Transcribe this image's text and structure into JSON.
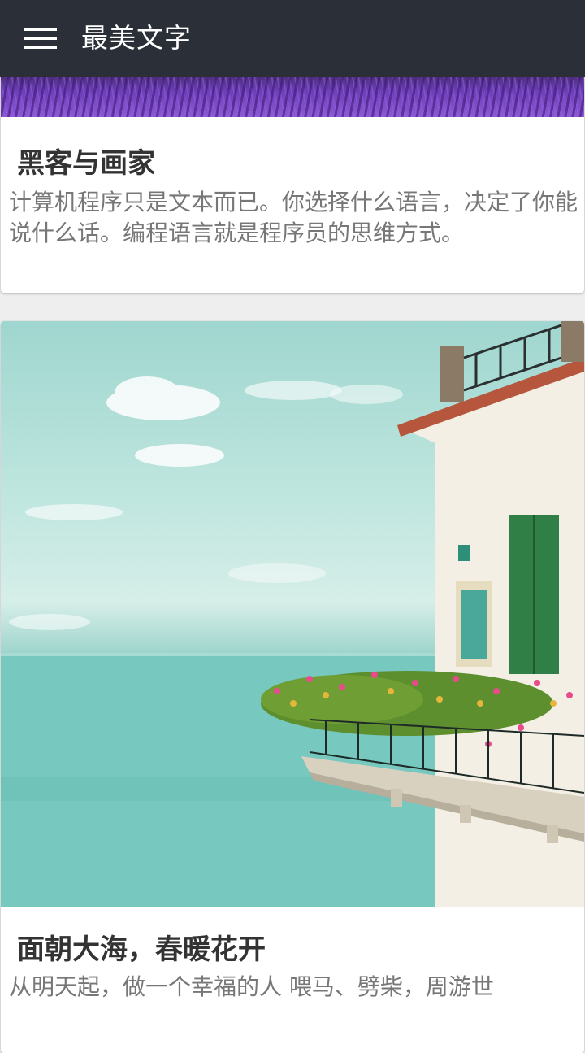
{
  "app_bar": {
    "title": "最美文字",
    "menu_icon": "hamburger-menu-icon"
  },
  "articles": [
    {
      "image": "lavender-field",
      "title": "黑客与画家",
      "body": "计算机程序只是文本而已。你选择什么语言，决定了你能说什么话。编程语言就是程序员的思维方式。"
    },
    {
      "image": "seaside-balcony-with-flowers",
      "title": "面朝大海，春暖花开",
      "body": "从明天起，做一个幸福的人 喂马、劈柴，周游世"
    }
  ],
  "colors": {
    "app_bar_bg": "#2b2f38",
    "app_bar_text": "#ffffff",
    "card_bg": "#ffffff",
    "title_text": "#333333",
    "body_text": "#777777",
    "page_bg": "#eeeeee"
  }
}
